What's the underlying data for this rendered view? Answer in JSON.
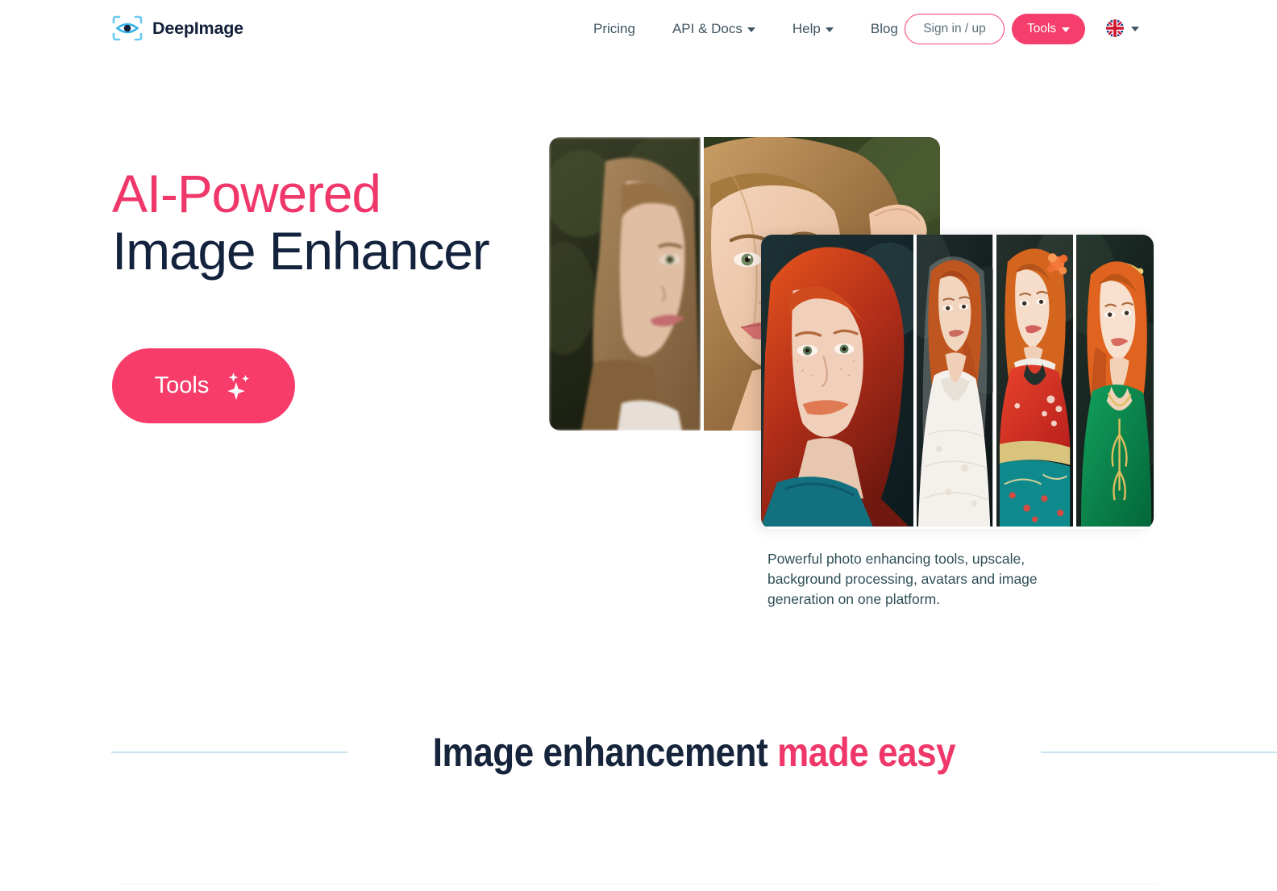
{
  "brand": {
    "name": "DeepImage",
    "logo_icon": "eye-scan-icon",
    "logo_color": "#5cc5f0"
  },
  "theme": {
    "accent_pink": "#f53e6b",
    "navy": "#14233d",
    "nav_text": "#3f5562",
    "caption_text": "#2f4f57",
    "rule_blue": "#c5e4f2"
  },
  "nav": {
    "items": [
      {
        "label": "Pricing",
        "has_caret": false
      },
      {
        "label": "API & Docs",
        "has_caret": true
      },
      {
        "label": "Help",
        "has_caret": true
      },
      {
        "label": "Blog",
        "has_caret": false
      }
    ],
    "signin_label": "Sign in / up",
    "tools_label": "Tools",
    "language": {
      "flag": "uk-flag-icon",
      "has_caret": true
    }
  },
  "hero": {
    "title_line1": "AI-Powered",
    "title_line2": "Image Enhancer",
    "cta_label": "Tools",
    "cta_icon": "sparkles-icon",
    "caption": "Powerful photo enhancing tools, upscale, background processing, avatars and image generation on one platform.",
    "image_cards": [
      {
        "name": "before-after-portrait",
        "panels": [
          "before-blurry-portrait",
          "after-enhanced-portrait"
        ]
      },
      {
        "name": "avatar-showcase",
        "panels": [
          "redhead-portrait",
          "bride-white-dress",
          "kimono-avatar",
          "green-dress-avatar"
        ]
      }
    ]
  },
  "section": {
    "heading_dark": "Image enhancement",
    "heading_pink": "made easy"
  }
}
